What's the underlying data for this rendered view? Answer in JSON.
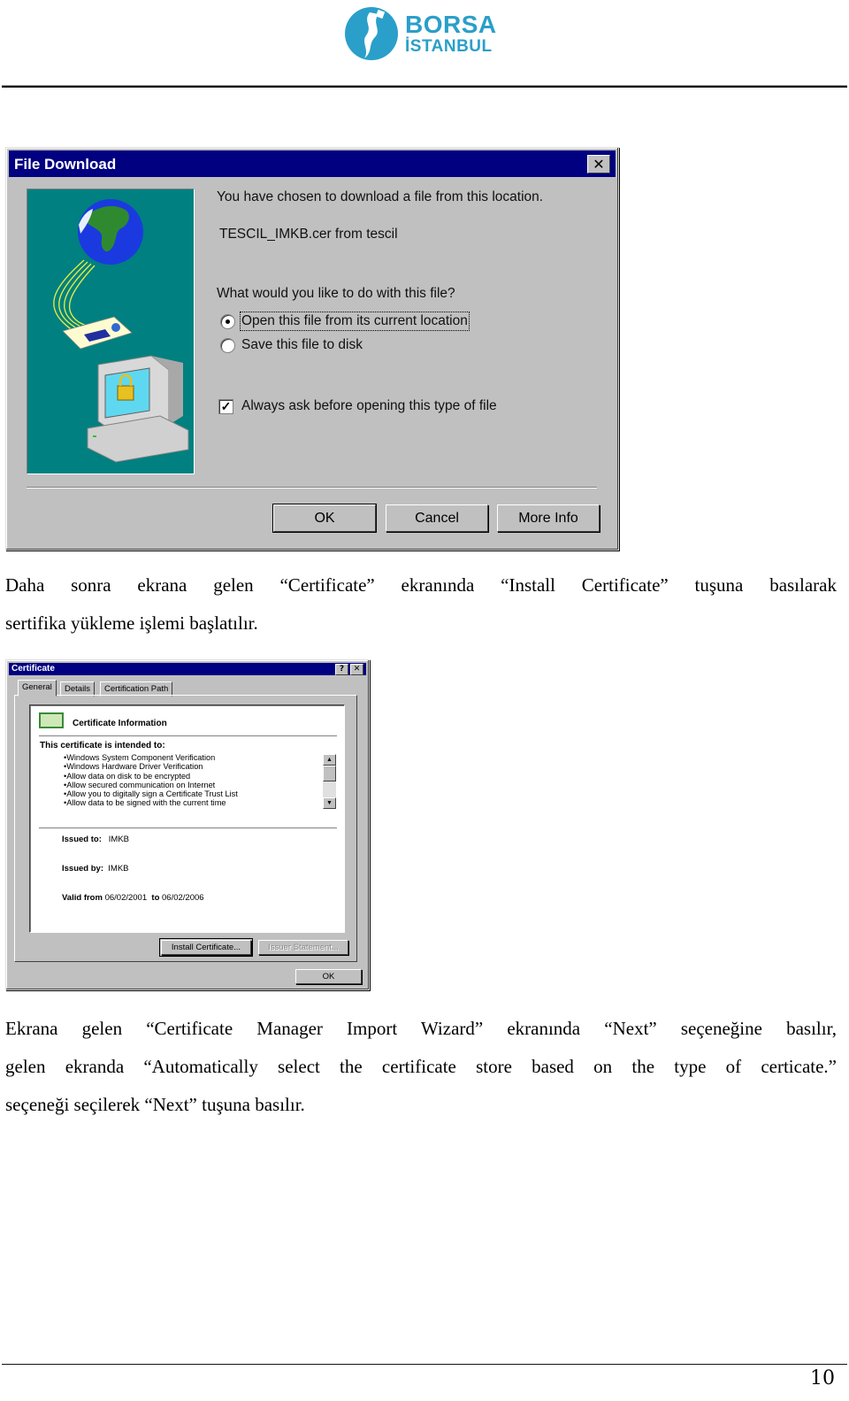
{
  "header": {
    "logo_line1": "BORSA",
    "logo_line2": "İSTANBUL",
    "brand_color": "#2a9fc9"
  },
  "file_download_dialog": {
    "title": "File Download",
    "close_icon": "close-icon",
    "intro": "You have chosen to download a file from this location.",
    "file": "TESCIL_IMKB.cer from tescil",
    "question": "What would you like to do with this file?",
    "options": [
      {
        "label": "Open this file from its current location",
        "selected": true
      },
      {
        "label": "Save this file to disk",
        "selected": false
      }
    ],
    "always_ask_label": "Always ask before opening this type of file",
    "always_ask_checked": true,
    "buttons": {
      "ok": "OK",
      "cancel": "Cancel",
      "more_info": "More Info"
    },
    "illustration": "globe-certificate-computer-lock"
  },
  "paragraph1": {
    "line1": "Daha sonra ekrana gelen “Certificate” ekranında “Install Certificate”  tuşuna basılarak",
    "line2": "sertifika yükleme işlemi başlatılır."
  },
  "certificate_dialog": {
    "title": "Certificate",
    "help_label": "?",
    "close_label": "✕",
    "tabs": [
      "General",
      "Details",
      "Certification Path"
    ],
    "active_tab": "General",
    "info_title": "Certificate Information",
    "intended_heading": "This certificate is intended to:",
    "purposes": [
      "•Windows System Component Verification",
      "•Windows Hardware Driver Verification",
      "•Allow data on disk to be encrypted",
      "•Allow secured communication on Internet",
      "•Allow you to digitally sign a Certificate Trust List",
      "•Allow data to be signed with the current time"
    ],
    "issued_to_label": "Issued to:",
    "issued_to": "IMKB",
    "issued_by_label": "Issued by:",
    "issued_by": "IMKB",
    "valid_from_label": "Valid from",
    "valid_from": "06/02/2001",
    "valid_to_label": "to",
    "valid_to": "06/02/2006",
    "buttons": {
      "install": "Install Certificate...",
      "issuer_statement": "Issuer Statement...",
      "ok": "OK"
    }
  },
  "paragraph2": {
    "line1": "Ekrana gelen “Certificate Manager Import Wizard” ekranında  “Next”  seçeneğine basılır,",
    "line2": "gelen ekranda “Automatically select the certificate store based on the type of certicate.”",
    "line3": "seçeneği seçilerek “Next” tuşuna basılır."
  },
  "footer": {
    "page_number": "10"
  }
}
